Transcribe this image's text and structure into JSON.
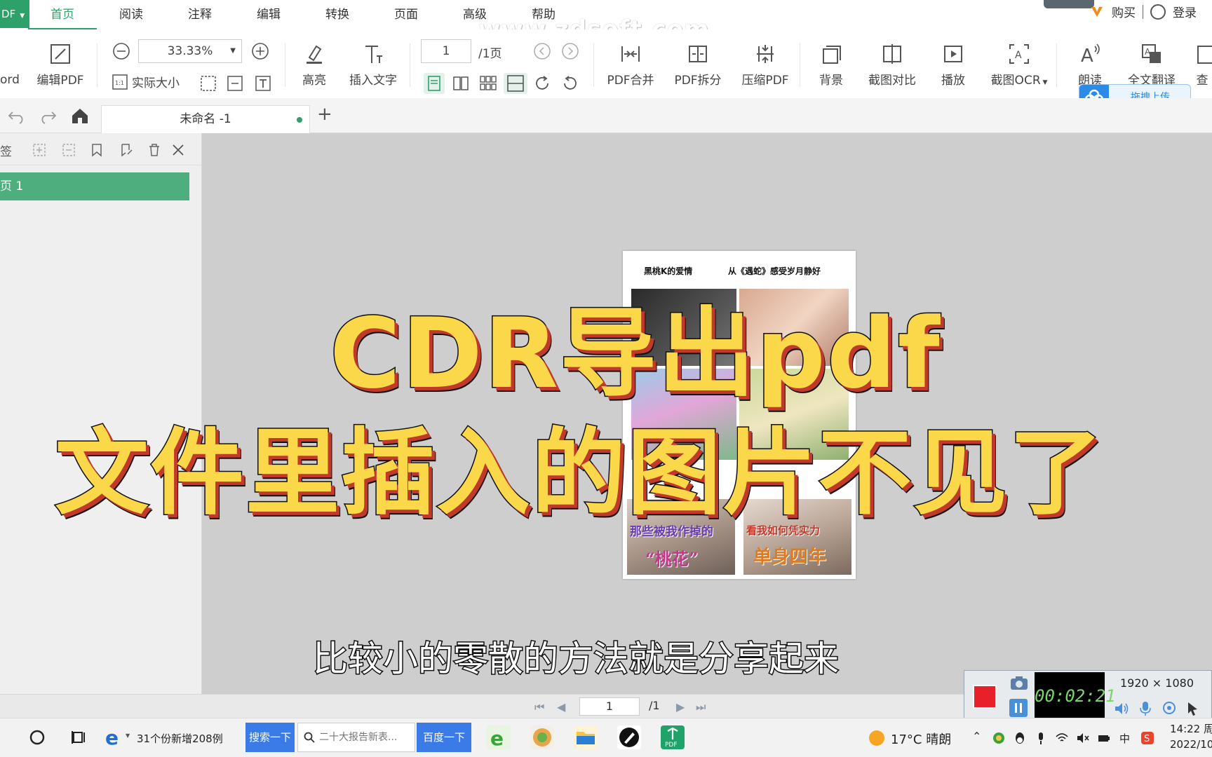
{
  "menu": {
    "app_badge": "DF",
    "tabs": [
      "首页",
      "阅读",
      "注释",
      "编辑",
      "转换",
      "页面",
      "高级",
      "帮助"
    ],
    "active_tab": "首页",
    "buy": "购买",
    "login": "登录"
  },
  "watermark": "www.zdsoft.com",
  "toolbar": {
    "word": "ord",
    "edit_pdf": "编辑PDF",
    "zoom": "33.33%",
    "actual_size": "实际大小",
    "highlight": "高亮",
    "insert_text": "插入文字",
    "page_num": "1",
    "page_total": "/1页",
    "merge": "PDF合并",
    "split": "PDF拆分",
    "compress": "压缩PDF",
    "background": "背景",
    "compare": "截图对比",
    "play": "播放",
    "ocr": "截图OCR",
    "read": "朗读",
    "translate": "全文翻译",
    "more": "查",
    "upload": "拖拽上传"
  },
  "tabs": {
    "doc_title": "未命名 -1"
  },
  "sidebar": {
    "title": "签",
    "item": "页 1"
  },
  "document": {
    "header_left": "黑桃K的爱情",
    "header_right": "从《遇蛇》感受岁月静好",
    "cap_1": "那些被我作掉的",
    "cap_2": "“桃花”",
    "cap_3": "看我如何凭实力",
    "cap_4": "单身四年"
  },
  "overlay": {
    "title_1": "CDR导出pdf",
    "title_2": "文件里插入的图片不见了",
    "subtitle": "比较小的零散的方法就是分享起来"
  },
  "bottom_nav": {
    "page": "1",
    "total": "/1"
  },
  "recorder": {
    "timer": "00:02:21",
    "resolution": "1920 × 1080"
  },
  "taskbar": {
    "news": "31个份新增208例",
    "search_btn": "搜索一下",
    "search_placeholder": "二十大报告新表...",
    "go_btn": "百度一下",
    "weather": "17°C 晴朗",
    "time": "14:22 周",
    "date": "2022/10"
  },
  "colors": {
    "accent_green": "#2ea06a",
    "title_yellow": "#fbd84a",
    "title_red": "#c0392b"
  }
}
